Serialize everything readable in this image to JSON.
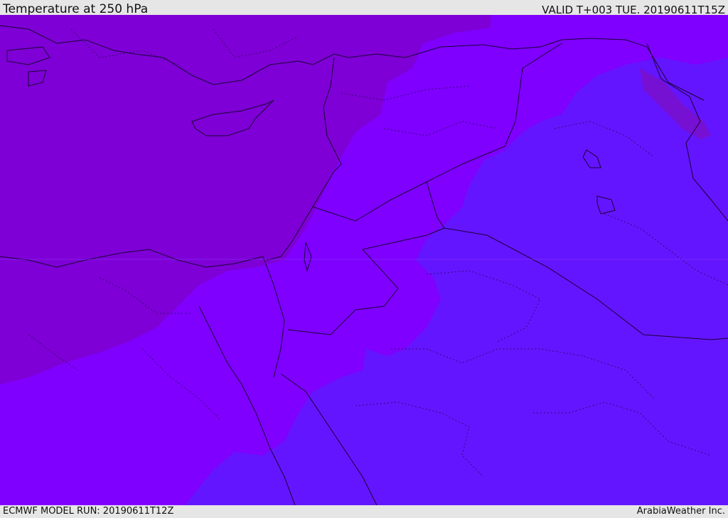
{
  "header": {
    "title": "Temperature at 250 hPa",
    "valid": "VALID T+003 TUE. 20190611T15Z"
  },
  "footer": {
    "model_run": "ECMWF MODEL RUN: 20190611T12Z",
    "credit": "ArabiaWeather Inc."
  },
  "colors": {
    "zone_warm": "#7e00d6",
    "zone_mid": "#7f00ff",
    "zone_cool": "#6415ff",
    "land_patch": "#7a0fc8",
    "border": "#1a0033",
    "background_bar": "#e6e6e6"
  }
}
